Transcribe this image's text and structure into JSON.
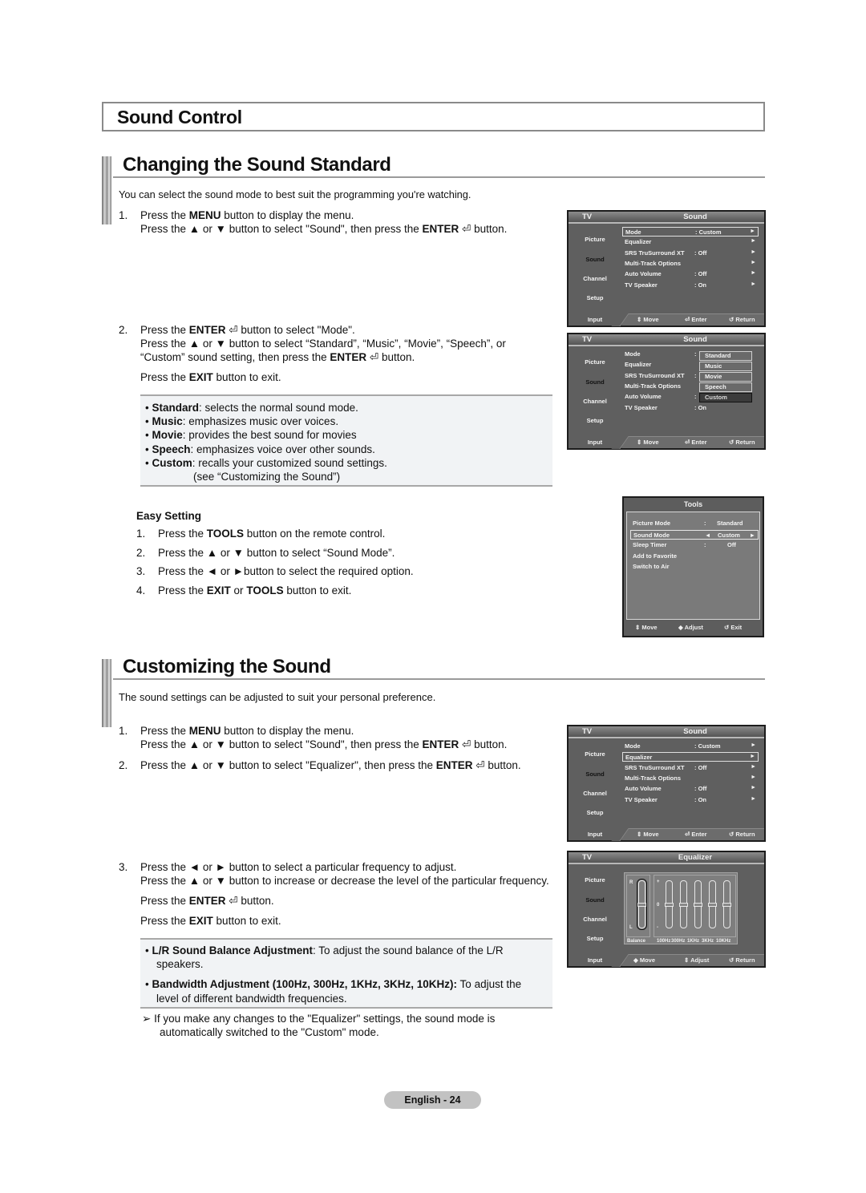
{
  "section_title": "Sound Control",
  "sections": [
    {
      "heading": "Changing the Sound Standard",
      "intro": "You can select the sound mode to best suit the programming you're watching.",
      "steps": [
        {
          "num": "1.",
          "lines": [
            [
              {
                "t": "Press the "
              },
              {
                "b": "MENU"
              },
              {
                "t": " button to display the menu."
              }
            ],
            [
              {
                "t": "Press the ▲ or ▼ button to select \"Sound\", then press the "
              },
              {
                "b": "ENTER"
              },
              {
                "t": " ⏎ button."
              }
            ]
          ]
        },
        {
          "num": "2.",
          "lines": [
            [
              {
                "t": "Press the "
              },
              {
                "b": "ENTER"
              },
              {
                "t": " ⏎ button to select \"Mode\"."
              }
            ],
            [
              {
                "t": "Press the ▲ or ▼ button to select “Standard”, “Music”, “Movie”, “Speech”, or"
              }
            ],
            [
              {
                "t": "“Custom” sound setting, then press the "
              },
              {
                "b": "ENTER"
              },
              {
                "t": " ⏎ button."
              }
            ],
            [
              {
                "t": "Press the "
              },
              {
                "b": "EXIT"
              },
              {
                "t": " button to exit."
              }
            ]
          ]
        }
      ],
      "notes": [
        {
          "term": "Standard",
          "desc": ": selects the normal sound mode."
        },
        {
          "term": "Music",
          "desc": ": emphasizes music over voices."
        },
        {
          "term": "Movie",
          "desc": ": provides the best sound for movies"
        },
        {
          "term": "Speech",
          "desc": ": emphasizes voice over other sounds."
        },
        {
          "term": "Custom",
          "desc": ": recalls your customized sound settings."
        }
      ],
      "notes_cont": "(see “Customizing the Sound”)",
      "easy_setting": {
        "title": "Easy Setting",
        "steps": [
          {
            "num": "1.",
            "parts": [
              {
                "t": "Press the "
              },
              {
                "b": "TOOLS"
              },
              {
                "t": " button on the remote control."
              }
            ]
          },
          {
            "num": "2.",
            "parts": [
              {
                "t": "Press the ▲ or ▼ button to select “Sound Mode”."
              }
            ]
          },
          {
            "num": "3.",
            "parts": [
              {
                "t": "Press the ◄ or ►button to select the required option."
              }
            ]
          },
          {
            "num": "4.",
            "parts": [
              {
                "t": "Press the "
              },
              {
                "b": "EXIT"
              },
              {
                "t": " or "
              },
              {
                "b": "TOOLS"
              },
              {
                "t": " button to exit."
              }
            ]
          }
        ]
      }
    },
    {
      "heading": "Customizing the Sound",
      "intro": "The sound settings can be adjusted to suit your personal preference.",
      "steps": [
        {
          "num": "1.",
          "lines": [
            [
              {
                "t": "Press the "
              },
              {
                "b": "MENU"
              },
              {
                "t": " button to display the menu."
              }
            ],
            [
              {
                "t": "Press the ▲ or ▼ button to select \"Sound\", then press the "
              },
              {
                "b": "ENTER"
              },
              {
                "t": " ⏎ button."
              }
            ]
          ]
        },
        {
          "num": "2.",
          "lines": [
            [
              {
                "t": "Press the ▲ or ▼ button to select \"Equalizer\", then press the "
              },
              {
                "b": "ENTER"
              },
              {
                "t": " ⏎ button."
              }
            ]
          ]
        },
        {
          "num": "3.",
          "lines": [
            [
              {
                "t": "Press the ◄ or ► button to select a particular frequency to adjust."
              }
            ],
            [
              {
                "t": "Press the ▲ or ▼ button to increase or decrease the level of the particular frequency."
              }
            ],
            [
              {
                "t": "Press the "
              },
              {
                "b": "ENTER"
              },
              {
                "t": " ⏎ button."
              }
            ],
            [
              {
                "t": "Press the "
              },
              {
                "b": "EXIT"
              },
              {
                "t": " button to exit."
              }
            ]
          ]
        }
      ],
      "notes": [
        {
          "term": "L/R Sound Balance Adjustment",
          "desc": ": To adjust the sound balance of the L/R",
          "cont": "speakers."
        },
        {
          "term": "Bandwidth Adjustment (100Hz, 300Hz, 1KHz, 3KHz, 10KHz):",
          "desc": " To adjust the",
          "cont": "level of different bandwidth frequencies."
        }
      ],
      "tip": "If you make any changes to the \"Equalizer\" settings, the sound mode is",
      "tip_cont": "automatically switched to the \"Custom\" mode."
    }
  ],
  "osd": {
    "tv_label": "TV",
    "sound_title": "Sound",
    "equalizer_title": "Equalizer",
    "side_menu": [
      "Picture",
      "Sound",
      "Channel",
      "Setup",
      "Input"
    ],
    "active_side": "Sound",
    "sound_items": [
      {
        "label": "Mode",
        "value": ": Custom"
      },
      {
        "label": "Equalizer",
        "value": ""
      },
      {
        "label": "SRS TruSurround XT",
        "value": ": Off"
      },
      {
        "label": "Multi-Track Options",
        "value": ""
      },
      {
        "label": "Auto Volume",
        "value": ": Off"
      },
      {
        "label": "TV Speaker",
        "value": ": On"
      }
    ],
    "arrow": "►",
    "mode_options": [
      "Standard",
      "Music",
      "Movie",
      "Speech",
      "Custom"
    ],
    "mode_selected": "Custom",
    "footer": {
      "move": "⇕ Move",
      "enter": "⏎ Enter",
      "return": "↺ Return",
      "move_lr": "◆ Move",
      "adjust": "⇕ Adjust"
    },
    "equalizer": {
      "balance_label": "Balance",
      "r_label": "R",
      "l_label": "L",
      "plus": "+",
      "zero": "0",
      "minus": "-",
      "balance_value": 0.5,
      "bands": [
        {
          "label": "100Hz",
          "level": 0.5
        },
        {
          "label": "300Hz",
          "level": 0.5
        },
        {
          "label": "1KHz",
          "level": 0.5
        },
        {
          "label": "3KHz",
          "level": 0.5
        },
        {
          "label": "10KHz",
          "level": 0.5
        }
      ]
    }
  },
  "tools_menu": {
    "title": "Tools",
    "rows": [
      {
        "label": "Picture Mode",
        "sep": ":",
        "value": "Standard"
      },
      {
        "label": "Sound Mode",
        "sep": "◄",
        "value": "Custom",
        "right": "►"
      },
      {
        "label": "Sleep Timer",
        "sep": ":",
        "value": "Off"
      },
      {
        "label": "Add to Favorite"
      },
      {
        "label": "Switch to Air"
      }
    ],
    "selected": "Sound Mode",
    "footer": {
      "move": "⇕ Move",
      "adjust": "◆ Adjust",
      "exit": "↺ Exit"
    }
  },
  "page_label": "English - 24"
}
